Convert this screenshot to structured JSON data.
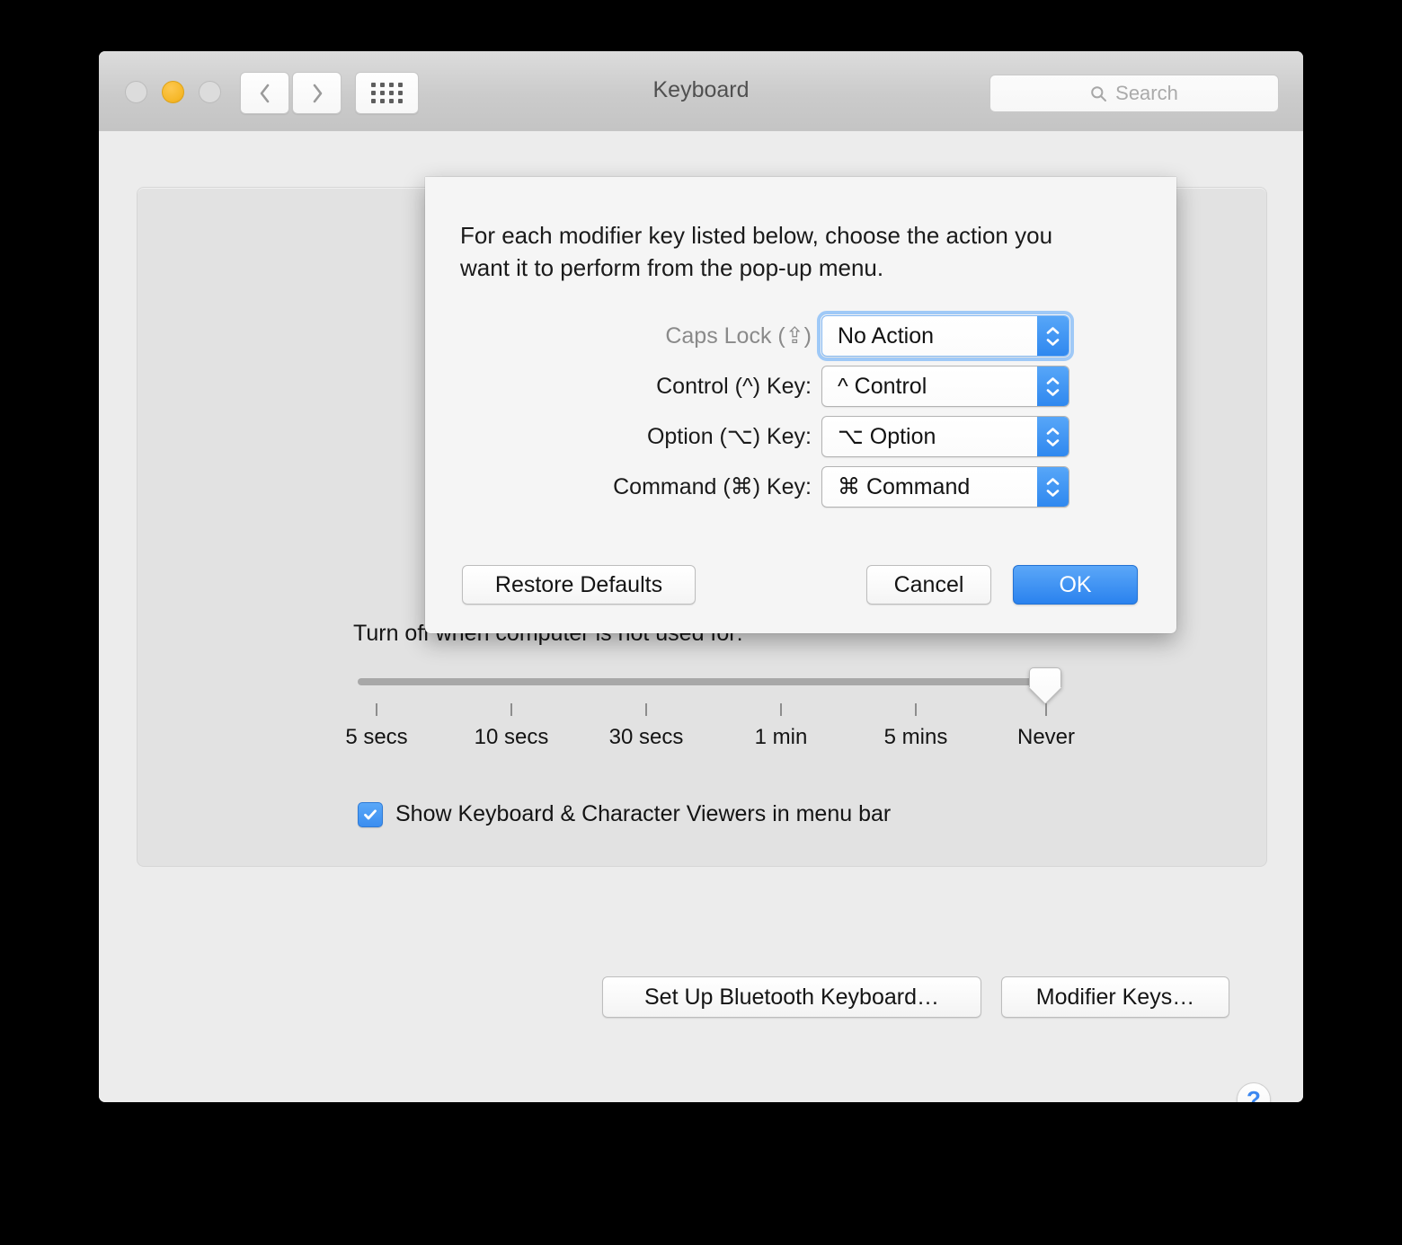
{
  "window": {
    "title": "Keyboard",
    "traffic_lights": [
      {
        "name": "close",
        "state": "disabled"
      },
      {
        "name": "minimize",
        "state": "enabled"
      },
      {
        "name": "zoom",
        "state": "disabled"
      }
    ],
    "nav": {
      "back_icon": "chevron-left-icon",
      "forward_icon": "chevron-right-icon",
      "show_all_icon": "grid-icon"
    },
    "search": {
      "icon": "search-icon",
      "placeholder": "Search",
      "value": ""
    }
  },
  "sheet": {
    "instruction": "For each modifier key listed below, choose the action you want it to perform from the pop-up menu.",
    "rows": [
      {
        "label": "Caps Lock (⇪)",
        "value": "No Action",
        "disabled": true,
        "focused": true
      },
      {
        "label": "Control (^) Key:",
        "value": "^ Control",
        "disabled": false,
        "focused": false
      },
      {
        "label": "Option (⌥) Key:",
        "value": "⌥ Option",
        "disabled": false,
        "focused": false
      },
      {
        "label": "Command (⌘) Key:",
        "value": "⌘ Command",
        "disabled": false,
        "focused": false
      }
    ],
    "buttons": {
      "restore_defaults": "Restore Defaults",
      "cancel": "Cancel",
      "ok": "OK"
    }
  },
  "pane": {
    "slider_label": "Turn off when computer is not used for:",
    "slider": {
      "ticks": [
        "5 secs",
        "10 secs",
        "30 secs",
        "1 min",
        "5 mins",
        "Never"
      ],
      "selected": "Never",
      "selected_index": 5
    },
    "checkbox": {
      "label": "Show Keyboard & Character Viewers in menu bar",
      "checked": true,
      "check_icon": "checkmark-icon"
    },
    "buttons": {
      "setup_bluetooth": "Set Up Bluetooth Keyboard…",
      "modifier_keys": "Modifier Keys…"
    },
    "help_button": "?"
  },
  "colors": {
    "accent_blue": "#2f88ef",
    "window_chrome": "#cbcbcb",
    "panel_bg": "#e2e2e2",
    "sheet_bg": "#f5f5f5",
    "minimize_yellow": "#f6b829"
  }
}
